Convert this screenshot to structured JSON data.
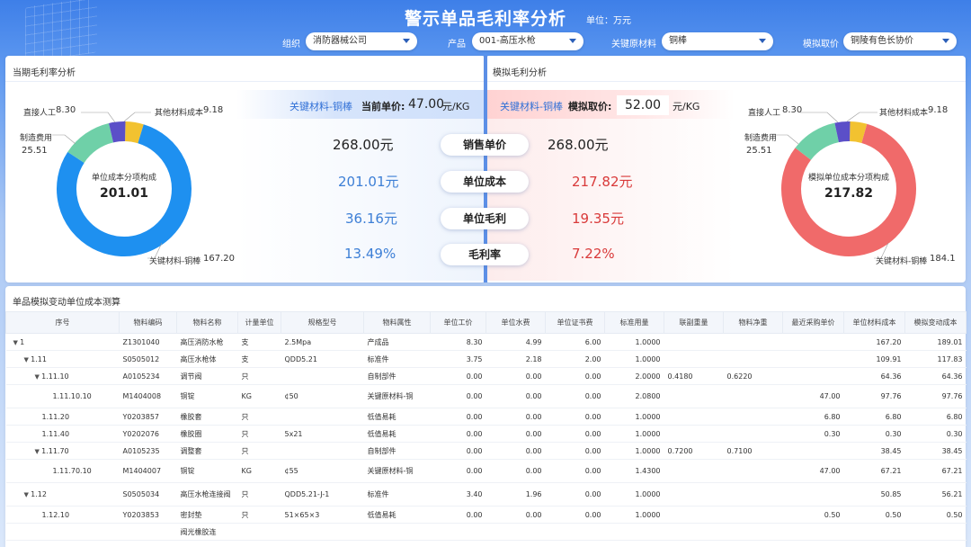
{
  "header": {
    "title": "警示单品毛利率分析",
    "unit": "单位：万元",
    "filters": [
      {
        "label": "组织",
        "value": "消防器械公司"
      },
      {
        "label": "产品",
        "value": "001-高压水枪"
      },
      {
        "label": "关键原材料",
        "value": "铜棒"
      },
      {
        "label": "模拟取价",
        "value": "铜陵有色长协价"
      }
    ]
  },
  "current": {
    "title": "当期毛利率分析",
    "key_material": "关键材料-铜棒",
    "price_label": "当前单价:",
    "price": "47.00",
    "price_unit": "元/KG",
    "donut_center_label": "单位成本分项构成",
    "donut_center_value": "201.01",
    "legend": [
      {
        "name": "直接人工",
        "value": "8.30"
      },
      {
        "name": "其他材料成本",
        "value": "9.18"
      },
      {
        "name": "制造费用",
        "value": "25.51"
      },
      {
        "name": "关键材料-铜棒",
        "value": "167.20"
      }
    ],
    "sales_price": "268.00元",
    "unit_cost": "201.01元",
    "unit_margin": "36.16元",
    "margin_rate": "13.49%"
  },
  "simulated": {
    "title": "模拟毛利分析",
    "key_material": "关键材料-铜棒",
    "price_label": "模拟取价:",
    "price": "52.00",
    "price_unit": "元/KG",
    "donut_center_label": "模拟单位成本分项构成",
    "donut_center_value": "217.82",
    "legend": [
      {
        "name": "直接人工",
        "value": "8.30"
      },
      {
        "name": "其他材料成本",
        "value": "9.18"
      },
      {
        "name": "制造费用",
        "value": "25.51"
      },
      {
        "name": "关键材料-铜棒",
        "value": "184.1"
      }
    ],
    "sales_price": "268.00元",
    "unit_cost": "217.82元",
    "unit_margin": "19.35元",
    "margin_rate": "7.22%"
  },
  "metrics": {
    "sales_price": "销售单价",
    "unit_cost": "单位成本",
    "unit_margin": "单位毛利",
    "margin_rate": "毛利率"
  },
  "colors": {
    "blue": "#1e90f0",
    "green": "#6fd0a8",
    "purple": "#5b4fc8",
    "yellow": "#f2c230",
    "red": "#f06a6a",
    "value_blue": "#3d7fd6",
    "value_red": "#d93a3a"
  },
  "table": {
    "title": "单品模拟变动单位成本测算",
    "headers": [
      "序号",
      "物料编码",
      "物料名称",
      "计量单位",
      "规格型号",
      "物料属性",
      "单位工价",
      "单位水费",
      "单位证书费",
      "标准用量",
      "联副重量",
      "物料净重",
      "最近采购单价",
      "单位材料成本",
      "模拟变动成本"
    ],
    "rows": [
      {
        "indent": 0,
        "arrow": true,
        "tall": false,
        "cells": [
          "1",
          "Z1301040",
          "高压消防水枪",
          "支",
          "2.5Mpa",
          "产成品",
          "8.30",
          "4.99",
          "6.00",
          "1.0000",
          "",
          "",
          "",
          "167.20",
          "189.01"
        ]
      },
      {
        "indent": 1,
        "arrow": true,
        "tall": false,
        "cells": [
          "1.11",
          "S0505012",
          "高压水枪体",
          "支",
          "QDD5.21",
          "标准件",
          "3.75",
          "2.18",
          "2.00",
          "1.0000",
          "",
          "",
          "",
          "109.91",
          "117.83"
        ]
      },
      {
        "indent": 2,
        "arrow": true,
        "tall": false,
        "cells": [
          "1.11.10",
          "A0105234",
          "调节阀",
          "只",
          "",
          "自制部件",
          "0.00",
          "0.00",
          "0.00",
          "2.0000",
          "0.4180",
          "0.6220",
          "",
          "64.36",
          "64.36"
        ]
      },
      {
        "indent": 3,
        "arrow": false,
        "tall": true,
        "cells": [
          "1.11.10.10",
          "M1404008",
          "铜锭",
          "KG",
          "¢50",
          "关键原材料-铜",
          "0.00",
          "0.00",
          "0.00",
          "2.0800",
          "",
          "",
          "47.00",
          "97.76",
          "97.76"
        ]
      },
      {
        "indent": 2,
        "arrow": false,
        "tall": false,
        "cells": [
          "1.11.20",
          "Y0203857",
          "橡胶套",
          "只",
          "",
          "低值易耗",
          "0.00",
          "0.00",
          "0.00",
          "1.0000",
          "",
          "",
          "6.80",
          "6.80",
          "6.80"
        ]
      },
      {
        "indent": 2,
        "arrow": false,
        "tall": false,
        "cells": [
          "1.11.40",
          "Y0202076",
          "橡胶圈",
          "只",
          "5x21",
          "低值易耗",
          "0.00",
          "0.00",
          "0.00",
          "1.0000",
          "",
          "",
          "0.30",
          "0.30",
          "0.30"
        ]
      },
      {
        "indent": 2,
        "arrow": true,
        "tall": false,
        "cells": [
          "1.11.70",
          "A0105235",
          "调整套",
          "只",
          "",
          "自制部件",
          "0.00",
          "0.00",
          "0.00",
          "1.0000",
          "0.7200",
          "0.7100",
          "",
          "38.45",
          "38.45"
        ]
      },
      {
        "indent": 3,
        "arrow": false,
        "tall": true,
        "cells": [
          "1.11.70.10",
          "M1404007",
          "铜锭",
          "KG",
          "¢55",
          "关键原材料-铜",
          "0.00",
          "0.00",
          "0.00",
          "1.4300",
          "",
          "",
          "47.00",
          "67.21",
          "67.21"
        ]
      },
      {
        "indent": 1,
        "arrow": true,
        "tall": true,
        "cells": [
          "1.12",
          "S0505034",
          "高压水枪连接阀",
          "只",
          "QDD5.21-J-1",
          "标准件",
          "3.40",
          "1.96",
          "0.00",
          "1.0000",
          "",
          "",
          "",
          "50.85",
          "56.21"
        ]
      },
      {
        "indent": 2,
        "arrow": false,
        "tall": false,
        "cells": [
          "1.12.10",
          "Y0203853",
          "密封垫",
          "只",
          "51×65×3",
          "低值易耗",
          "0.00",
          "0.00",
          "0.00",
          "1.0000",
          "",
          "",
          "0.50",
          "0.50",
          "0.50"
        ]
      },
      {
        "indent": 2,
        "arrow": false,
        "tall": false,
        "cells": [
          "",
          "",
          "阀光橡胶连",
          "",
          "",
          "",
          "",
          "",
          "",
          "",
          "",
          "",
          "",
          "",
          ""
        ]
      }
    ]
  }
}
